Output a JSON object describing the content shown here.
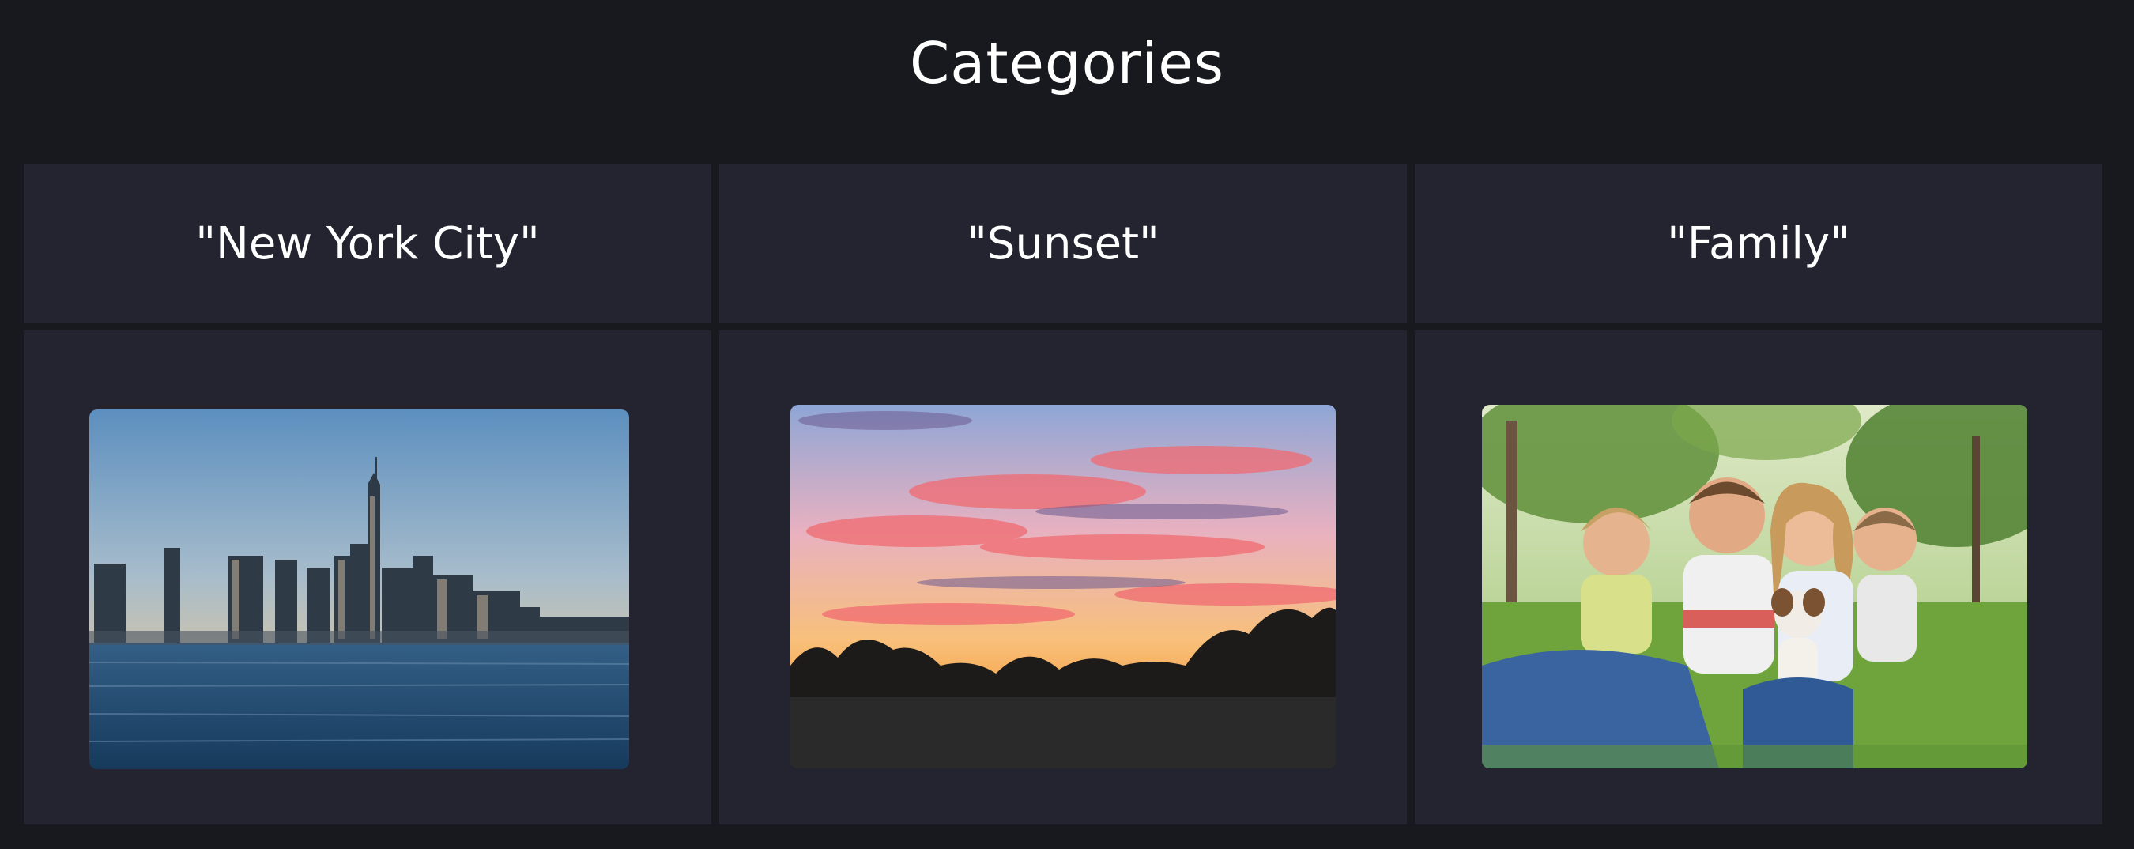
{
  "page": {
    "title": "Categories"
  },
  "categories": [
    {
      "label": "\"New York City\""
    },
    {
      "label": "\"Sunset\""
    },
    {
      "label": "\"Family\""
    }
  ],
  "colors": {
    "background": "#18191e",
    "card": "#23242f",
    "text": "#ffffff"
  }
}
